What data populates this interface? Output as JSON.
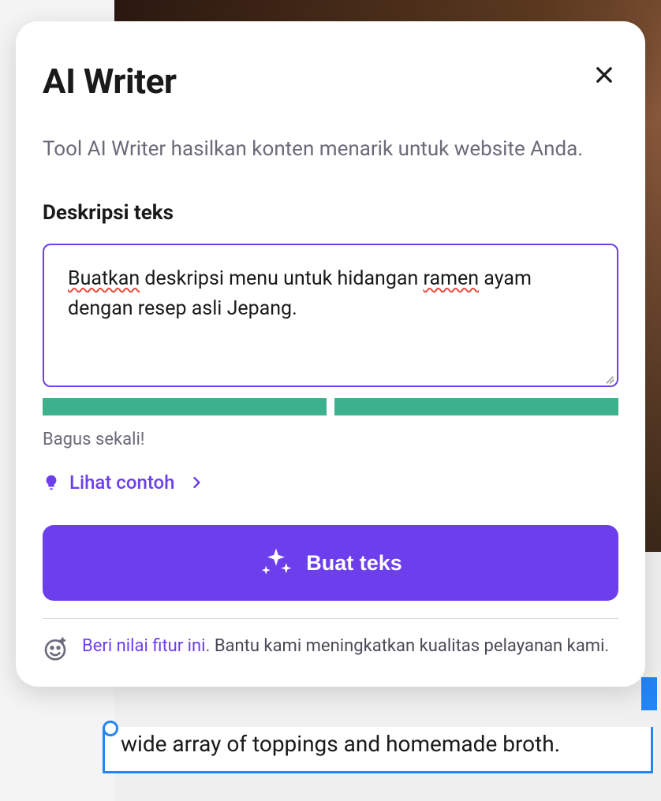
{
  "modal": {
    "title": "AI Writer",
    "description": "Tool AI Writer hasilkan konten menarik untuk website Anda.",
    "fieldLabel": "Deskripsi teks",
    "textareaValue": "Buatkan deskripsi menu untuk hidangan ramen ayam dengan resep asli Jepang.",
    "spellcheckWords": [
      "Buatkan",
      "ramen"
    ],
    "strengthText": "Bagus sekali!",
    "exampleLink": "Lihat contoh",
    "generateButton": "Buat teks",
    "feedbackLink": "Beri nilai fitur ini.",
    "feedbackText": "Bantu kami meningkatkan kualitas pelayanan kami."
  },
  "background": {
    "contentBelow": "wide array of toppings and homemade broth."
  },
  "colors": {
    "primary": "#6d3fec",
    "success": "#3db08c"
  }
}
